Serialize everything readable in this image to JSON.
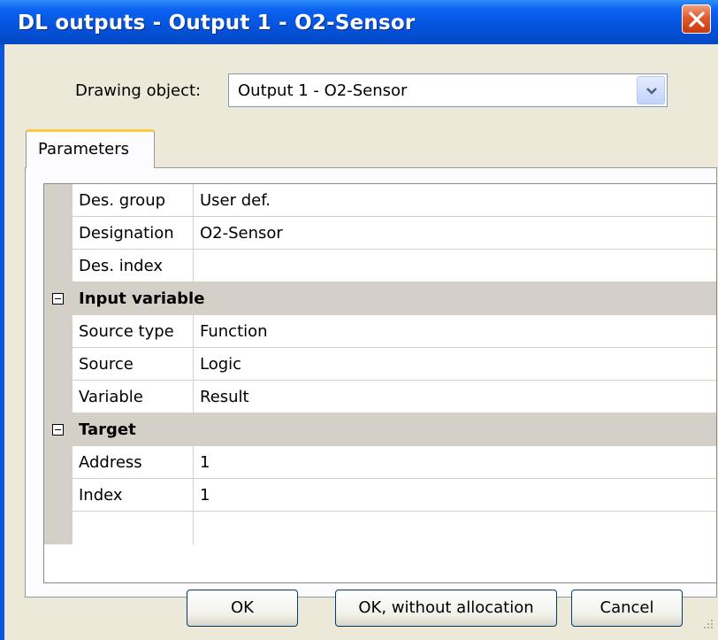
{
  "window": {
    "title": "DL outputs - Output 1 - O2-Sensor",
    "close_icon": "close-icon"
  },
  "drawing_object": {
    "label": "Drawing object:",
    "value": "Output 1 - O2-Sensor",
    "dropdown_icon": "chevron-down-icon"
  },
  "tabs": [
    {
      "label": "Parameters",
      "selected": true
    }
  ],
  "properties": {
    "general": [
      {
        "name": "Des. group",
        "value": "User def."
      },
      {
        "name": "Designation",
        "value": "O2-Sensor"
      },
      {
        "name": "Des. index",
        "value": ""
      }
    ],
    "input_variable": {
      "title": "Input variable",
      "expanded": true,
      "rows": [
        {
          "name": "Source type",
          "value": "Function"
        },
        {
          "name": "Source",
          "value": "Logic"
        },
        {
          "name": "Variable",
          "value": "Result"
        }
      ]
    },
    "target": {
      "title": "Target",
      "expanded": true,
      "rows": [
        {
          "name": "Address",
          "value": "1"
        },
        {
          "name": "Index",
          "value": "1"
        }
      ]
    }
  },
  "buttons": {
    "ok": "OK",
    "ok_without_allocation": "OK, without allocation",
    "cancel": "Cancel"
  },
  "colors": {
    "title_bar": "#0553dc",
    "dialog_bg": "#ece9d8",
    "category_bg": "#d4d0c8",
    "tab_highlight": "#ffc83c",
    "close_button": "#e05a2f"
  }
}
